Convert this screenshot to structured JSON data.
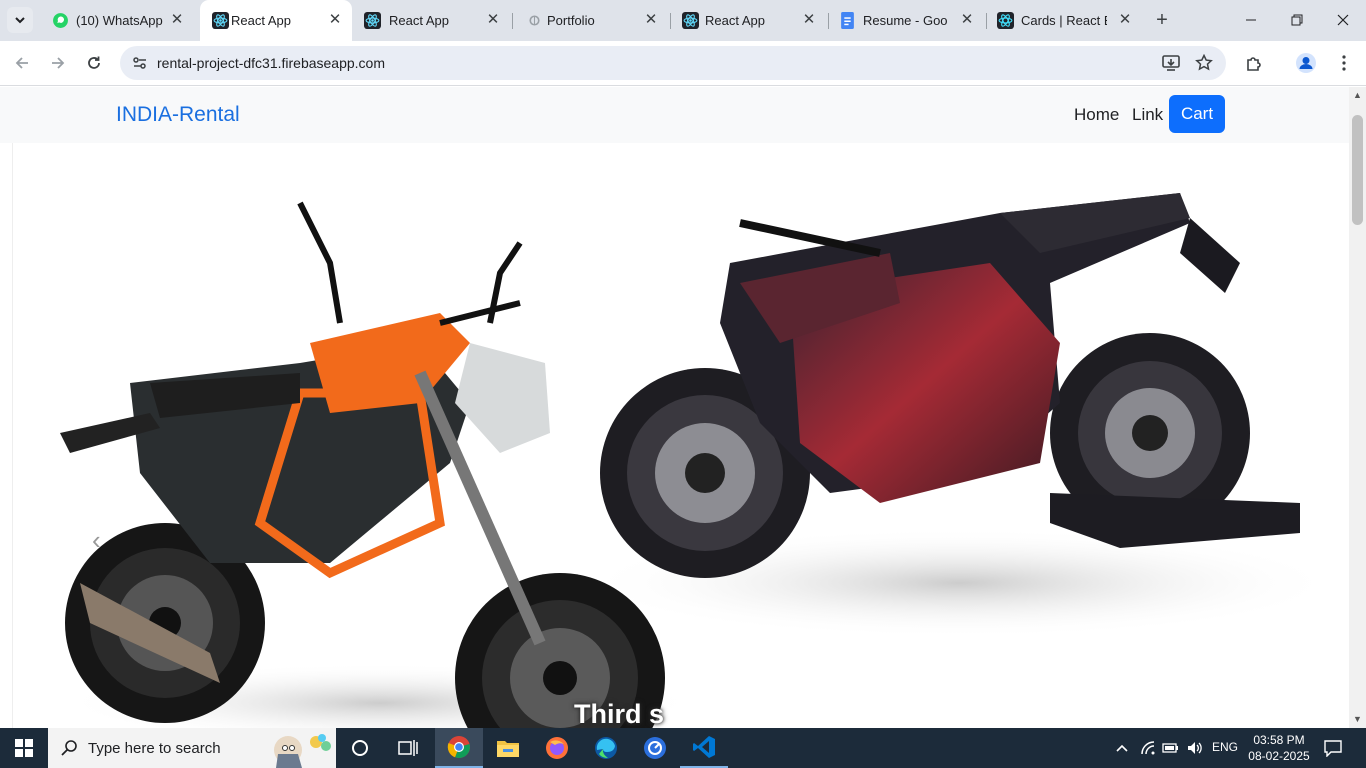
{
  "browser": {
    "tabs": [
      {
        "title": "(10) WhatsApp",
        "icon": "whatsapp-icon"
      },
      {
        "title": "React App",
        "icon": "react-icon",
        "active": true
      },
      {
        "title": "React App",
        "icon": "react-icon"
      },
      {
        "title": "Portfolio",
        "icon": "globe-icon"
      },
      {
        "title": "React App",
        "icon": "react-icon"
      },
      {
        "title": "Resume - Google Docs",
        "icon": "docs-icon"
      },
      {
        "title": "Cards | React Bootstrap",
        "icon": "react-bootstrap-icon"
      }
    ],
    "url": "rental-project-dfc31.firebaseapp.com"
  },
  "site": {
    "brand": "INDIA-Rental",
    "nav": {
      "home": "Home",
      "link": "Link",
      "cart": "Cart"
    },
    "carousel": {
      "caption": "Third s",
      "slide_image": "two motorcycles: orange KTM Duke and red electric sport bike"
    }
  },
  "taskbar": {
    "search_placeholder": "Type here to search",
    "language": "ENG",
    "time": "03:58 PM",
    "date": "08-02-2025"
  },
  "colors": {
    "brand": "#1a6fe0",
    "cart_button": "#0d6efd",
    "taskbar": "#1c2b3a"
  }
}
